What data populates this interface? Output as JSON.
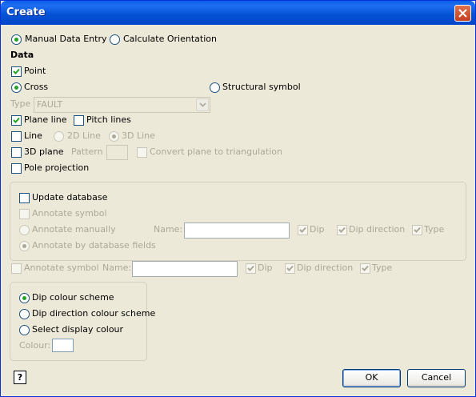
{
  "window": {
    "title": "Create"
  },
  "mode": {
    "manual": {
      "label": "Manual Data Entry",
      "selected": true
    },
    "calculate": {
      "label": "Calculate Orientation",
      "selected": false
    }
  },
  "data_heading": "Data",
  "point": {
    "label": "Point",
    "checked": true
  },
  "cross": {
    "label": "Cross",
    "selected": true
  },
  "structural": {
    "label": "Structural symbol",
    "selected": false
  },
  "type": {
    "label": "Type",
    "value": "FAULT"
  },
  "plane_line": {
    "label": "Plane line",
    "checked": true
  },
  "pitch_lines": {
    "label": "Pitch lines",
    "checked": false
  },
  "line": {
    "label": "Line",
    "checked": false,
    "line_2d": "2D Line",
    "line_3d": "3D Line"
  },
  "plane_3d": {
    "label": "3D plane",
    "checked": false,
    "pattern_label": "Pattern",
    "convert_label": "Convert plane to triangulation"
  },
  "pole_projection": {
    "label": "Pole projection",
    "checked": false
  },
  "db_group": {
    "update_database": "Update database",
    "annotate_symbol": "Annotate symbol",
    "annotate_manually": "Annotate manually",
    "annotate_db_fields": "Annotate by database fields",
    "name_label": "Name:",
    "dip": "Dip",
    "dip_direction": "Dip direction",
    "type": "Type"
  },
  "annot_row": {
    "annotate_symbol": "Annotate symbol",
    "name_label": "Name:",
    "dip": "Dip",
    "dip_direction": "Dip direction",
    "type": "Type"
  },
  "colour_group": {
    "dip_scheme": "Dip colour scheme",
    "dip_dir_scheme": "Dip direction colour scheme",
    "select_display": "Select display colour",
    "colour_label": "Colour:",
    "selected": "dip_scheme"
  },
  "buttons": {
    "ok": "OK",
    "cancel": "Cancel",
    "help": "?"
  },
  "colors": {
    "title_bar": "#0653d6",
    "radio_dot": "#21a121",
    "face": "#ece9d8"
  }
}
